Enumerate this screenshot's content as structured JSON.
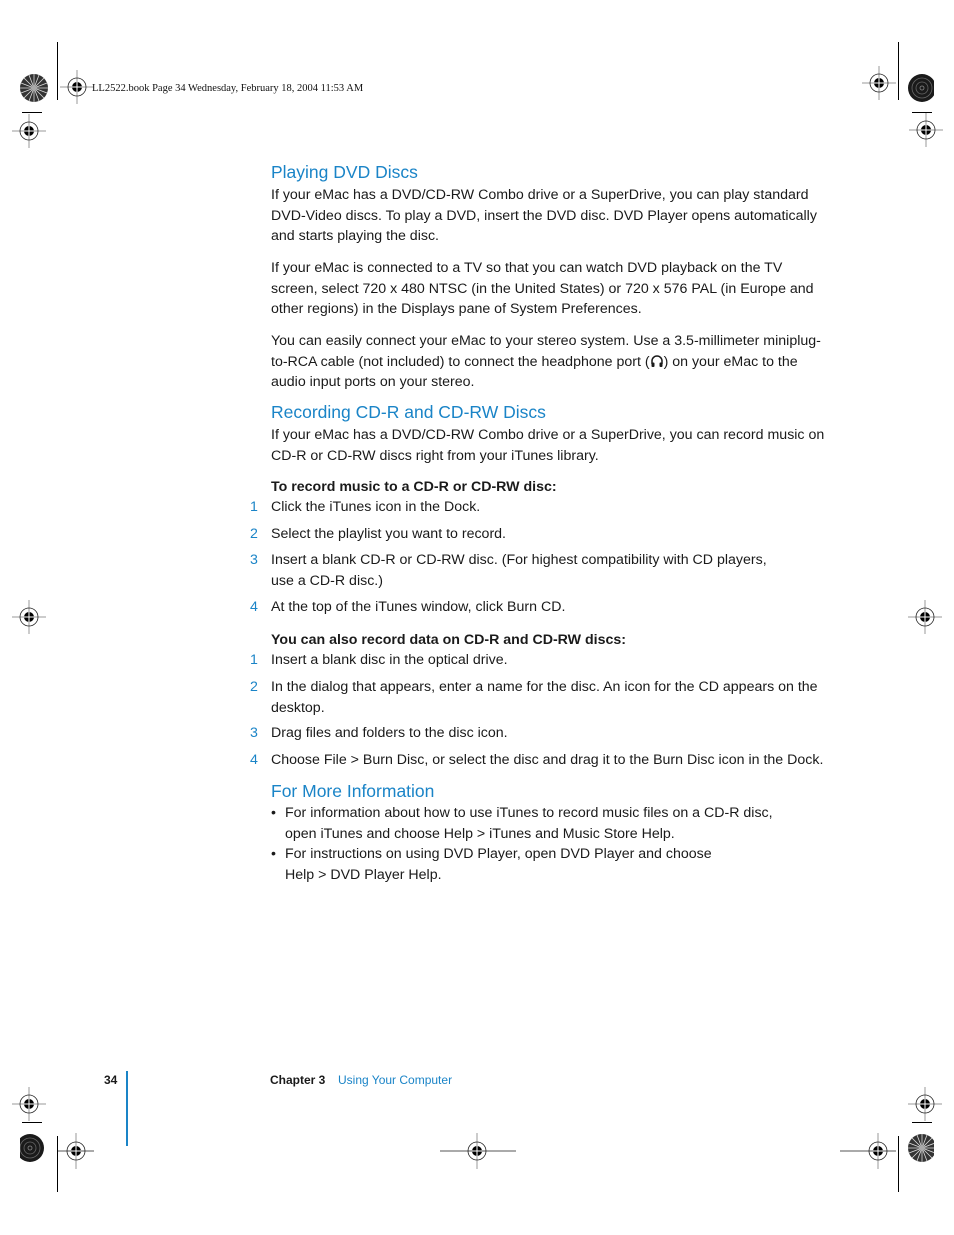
{
  "slug": "LL2522.book  Page 34  Wednesday, February 18, 2004  11:53 AM",
  "sections": [
    {
      "heading": "Playing DVD Discs",
      "paragraphs": [
        "If your eMac has a DVD/CD-RW Combo drive or a SuperDrive, you can play standard DVD-Video discs. To play a DVD, insert the DVD disc. DVD Player opens automatically and starts playing the disc.",
        "If your eMac is connected to a TV so that you can watch DVD playback on the TV screen, select 720 x 480 NTSC (in the United States) or 720 x 576 PAL (in Europe and other regions) in the Displays pane of System Preferences."
      ],
      "stereo_paragraph": {
        "before_icon": "You can easily connect your eMac to your stereo system. Use a 3.5-millimeter miniplug-to-RCA cable (not included) to connect the headphone port (",
        "icon": "headphone-icon",
        "after_icon": ") on your eMac to the audio input ports on your stereo."
      }
    },
    {
      "heading": "Recording CD-R and CD-RW Discs",
      "intro": "If your eMac has a DVD/CD-RW Combo drive or a SuperDrive, you can record music on CD-R or CD-RW discs right from your iTunes library.",
      "procedures": [
        {
          "lead": "To record music to a CD-R or CD-RW disc:",
          "steps": [
            {
              "num": "1",
              "text": "Click the iTunes icon in the Dock."
            },
            {
              "num": "2",
              "text": "Select the playlist you want to record."
            },
            {
              "num": "3",
              "text": "Insert a blank CD-R or CD-RW disc. (For highest compatibility with CD players, use a CD-R disc.)"
            },
            {
              "num": "4",
              "text": "At the top of the iTunes window, click Burn CD."
            }
          ]
        },
        {
          "lead": "You can also record data on CD-R and CD-RW discs:",
          "steps": [
            {
              "num": "1",
              "text": "Insert a blank disc in the optical drive."
            },
            {
              "num": "2",
              "text": "In the dialog that appears, enter a name for the disc. An icon for the CD appears on the desktop."
            },
            {
              "num": "3",
              "text": "Drag files and folders to the disc icon."
            },
            {
              "num": "4",
              "text": "Choose File > Burn Disc, or select the disc and drag it to the Burn Disc icon in the Dock."
            }
          ]
        }
      ]
    },
    {
      "heading": "For More Information",
      "bullets": [
        {
          "marker": "•",
          "text": "For information about how to use iTunes to record music files on a CD-R disc, open iTunes and choose Help > iTunes and Music Store Help."
        },
        {
          "marker": "•",
          "text": "For instructions on using DVD Player, open DVD Player and choose Help > DVD Player Help."
        }
      ]
    }
  ],
  "footer": {
    "page_number": "34",
    "chapter_label": "Chapter 3",
    "chapter_title": "Using Your Computer"
  },
  "colors": {
    "accent": "#1a84c7",
    "text": "#1a1a1a"
  }
}
